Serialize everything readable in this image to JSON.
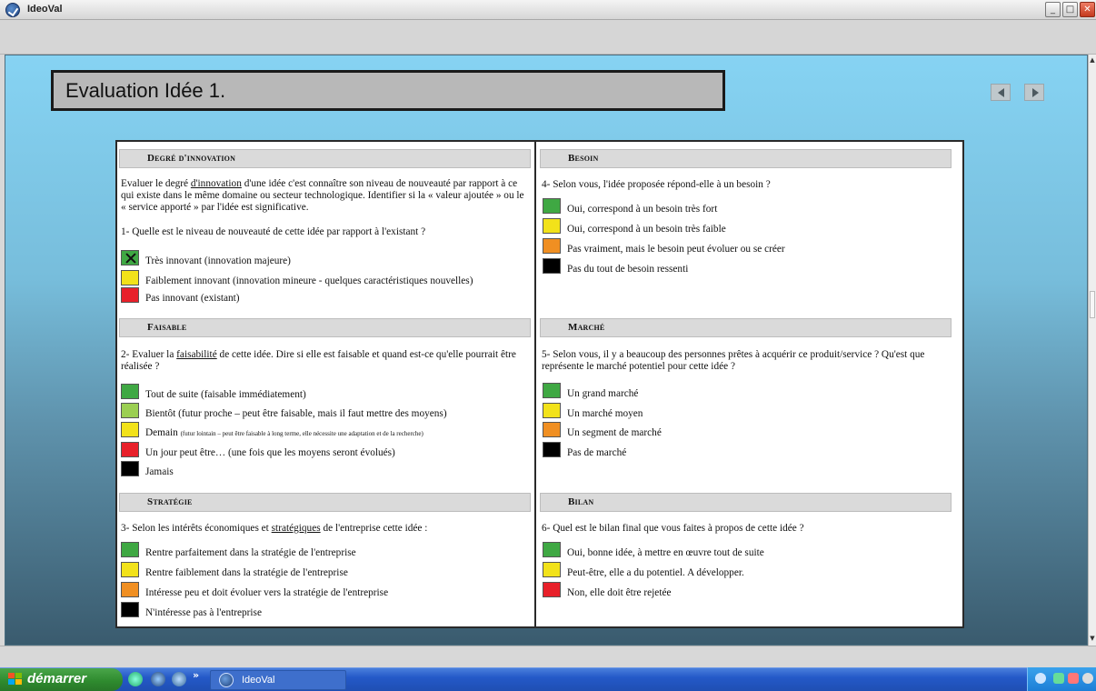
{
  "window": {
    "title": "IdeoVal"
  },
  "page": {
    "title": "Evaluation Idée 1."
  },
  "colors": {
    "green": "#3fa843",
    "lightgreen": "#9bcf52",
    "yellow": "#f2e21a",
    "orange": "#f08f22",
    "red": "#e8202a",
    "black": "#000000"
  },
  "sections": {
    "innovation": {
      "header": "Degré d'innovation",
      "intro_1": "Evaluer le degré",
      "intro_link": "d'innovation",
      "intro_2": "d'une idée c'est connaître son niveau de nouveauté par rapport à ce qui existe dans le même domaine ou secteur technologique. Identifier si la « valeur ajoutée » ou le « service apporté » par l'idée est significative.",
      "question": "1- Quelle est le niveau de nouveauté de cette idée par rapport à l'existant ?",
      "options": [
        {
          "label": "Très innovant (innovation majeure)",
          "color": "green",
          "checked": true
        },
        {
          "label": "Faiblement innovant (innovation mineure - quelques caractéristiques nouvelles)",
          "color": "yellow",
          "checked": false
        },
        {
          "label": "Pas innovant (existant)",
          "color": "red",
          "checked": false
        }
      ]
    },
    "faisable": {
      "header": "Faisable",
      "question_1": "2- Evaluer la",
      "question_link": "faisabilité",
      "question_2": "de cette idée. Dire si elle est faisable et quand est-ce qu'elle pourrait être réalisée ?",
      "options": [
        {
          "label": "Tout de suite (faisable immédiatement)",
          "color": "green"
        },
        {
          "label": "Bientôt (futur proche – peut être faisable, mais il faut mettre des moyens)",
          "color": "lightgreen"
        },
        {
          "label": "Demain",
          "small": "(futur lointain – peut être faisable à long terme, elle nécessite une adaptation et de la recherche)",
          "color": "yellow"
        },
        {
          "label": "Un jour peut être… (une fois que les moyens seront évolués)",
          "color": "red"
        },
        {
          "label": "Jamais",
          "color": "black"
        }
      ]
    },
    "strategie": {
      "header": "Stratégie",
      "question_1": "3- Selon les intérêts économiques et",
      "question_link": "stratégiques",
      "question_2": "de l'entreprise cette idée :",
      "options": [
        {
          "label": "Rentre parfaitement dans la stratégie de l'entreprise",
          "color": "green"
        },
        {
          "label": "Rentre faiblement dans la stratégie de l'entreprise",
          "color": "yellow"
        },
        {
          "label": "Intéresse peu et doit  évoluer vers la stratégie de l'entreprise",
          "color": "orange"
        },
        {
          "label": "N'intéresse pas à l'entreprise",
          "color": "black"
        }
      ]
    },
    "besoin": {
      "header": "Besoin",
      "question": "4- Selon vous, l'idée proposée répond-elle à un besoin ?",
      "options": [
        {
          "label": "Oui, correspond à un besoin très fort",
          "color": "green"
        },
        {
          "label": "Oui, correspond à un besoin très faible",
          "color": "yellow"
        },
        {
          "label": "Pas vraiment, mais le besoin peut évoluer ou se créer",
          "color": "orange"
        },
        {
          "label": "Pas du tout de besoin ressenti",
          "color": "black"
        }
      ]
    },
    "marche": {
      "header": "Marché",
      "question": "5- Selon vous, il y a beaucoup des personnes prêtes à acquérir ce produit/service ? Qu'est que représente le marché potentiel pour cette idée ?",
      "options": [
        {
          "label": "Un grand marché",
          "color": "green"
        },
        {
          "label": "Un marché moyen",
          "color": "yellow"
        },
        {
          "label": "Un segment de marché",
          "color": "orange"
        },
        {
          "label": "Pas de marché",
          "color": "black"
        }
      ]
    },
    "bilan": {
      "header": "Bilan",
      "question": "6- Quel est le bilan final que vous faites à propos de cette idée ?",
      "options": [
        {
          "label": "Oui, bonne idée, à mettre en œuvre tout de suite",
          "color": "green"
        },
        {
          "label": "Peut-être, elle  a du potentiel. A développer.",
          "color": "yellow"
        },
        {
          "label": "Non, elle doit être rejetée",
          "color": "red"
        }
      ]
    }
  },
  "taskbar": {
    "start_label": "démarrer",
    "task_label": "IdeoVal",
    "chevron": "»"
  }
}
